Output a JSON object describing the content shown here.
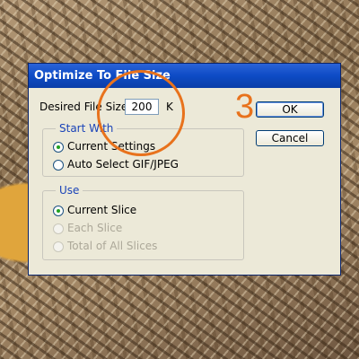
{
  "dialog": {
    "title": "Optimize To File Size",
    "desired_label": "Desired File Size:",
    "size_value": "200",
    "unit": "K",
    "start_with": {
      "title": "Start With",
      "options": [
        {
          "label": "Current Settings",
          "checked": true
        },
        {
          "label": "Auto Select GIF/JPEG",
          "checked": false
        }
      ]
    },
    "use": {
      "title": "Use",
      "options": [
        {
          "label": "Current Slice",
          "checked": true,
          "disabled": false
        },
        {
          "label": "Each Slice",
          "checked": false,
          "disabled": true
        },
        {
          "label": "Total of All Slices",
          "checked": false,
          "disabled": true
        }
      ]
    },
    "ok_label": "OK",
    "cancel_label": "Cancel"
  },
  "annotation": {
    "step_number": "3",
    "color": "#e8721c"
  }
}
